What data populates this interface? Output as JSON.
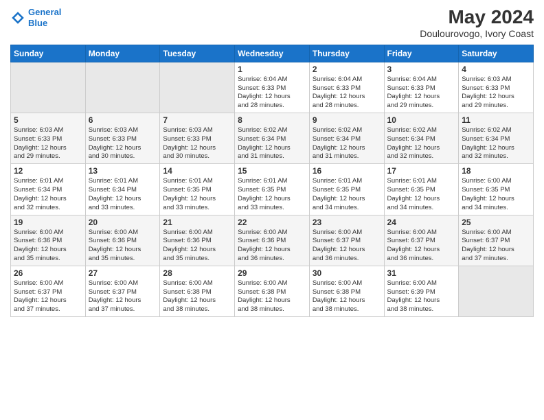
{
  "logo": {
    "line1": "General",
    "line2": "Blue"
  },
  "title": "May 2024",
  "subtitle": "Doulourovogo, Ivory Coast",
  "weekdays": [
    "Sunday",
    "Monday",
    "Tuesday",
    "Wednesday",
    "Thursday",
    "Friday",
    "Saturday"
  ],
  "weeks": [
    [
      {
        "day": "",
        "info": ""
      },
      {
        "day": "",
        "info": ""
      },
      {
        "day": "",
        "info": ""
      },
      {
        "day": "1",
        "info": "Sunrise: 6:04 AM\nSunset: 6:33 PM\nDaylight: 12 hours\nand 28 minutes."
      },
      {
        "day": "2",
        "info": "Sunrise: 6:04 AM\nSunset: 6:33 PM\nDaylight: 12 hours\nand 28 minutes."
      },
      {
        "day": "3",
        "info": "Sunrise: 6:04 AM\nSunset: 6:33 PM\nDaylight: 12 hours\nand 29 minutes."
      },
      {
        "day": "4",
        "info": "Sunrise: 6:03 AM\nSunset: 6:33 PM\nDaylight: 12 hours\nand 29 minutes."
      }
    ],
    [
      {
        "day": "5",
        "info": "Sunrise: 6:03 AM\nSunset: 6:33 PM\nDaylight: 12 hours\nand 29 minutes."
      },
      {
        "day": "6",
        "info": "Sunrise: 6:03 AM\nSunset: 6:33 PM\nDaylight: 12 hours\nand 30 minutes."
      },
      {
        "day": "7",
        "info": "Sunrise: 6:03 AM\nSunset: 6:33 PM\nDaylight: 12 hours\nand 30 minutes."
      },
      {
        "day": "8",
        "info": "Sunrise: 6:02 AM\nSunset: 6:34 PM\nDaylight: 12 hours\nand 31 minutes."
      },
      {
        "day": "9",
        "info": "Sunrise: 6:02 AM\nSunset: 6:34 PM\nDaylight: 12 hours\nand 31 minutes."
      },
      {
        "day": "10",
        "info": "Sunrise: 6:02 AM\nSunset: 6:34 PM\nDaylight: 12 hours\nand 32 minutes."
      },
      {
        "day": "11",
        "info": "Sunrise: 6:02 AM\nSunset: 6:34 PM\nDaylight: 12 hours\nand 32 minutes."
      }
    ],
    [
      {
        "day": "12",
        "info": "Sunrise: 6:01 AM\nSunset: 6:34 PM\nDaylight: 12 hours\nand 32 minutes."
      },
      {
        "day": "13",
        "info": "Sunrise: 6:01 AM\nSunset: 6:34 PM\nDaylight: 12 hours\nand 33 minutes."
      },
      {
        "day": "14",
        "info": "Sunrise: 6:01 AM\nSunset: 6:35 PM\nDaylight: 12 hours\nand 33 minutes."
      },
      {
        "day": "15",
        "info": "Sunrise: 6:01 AM\nSunset: 6:35 PM\nDaylight: 12 hours\nand 33 minutes."
      },
      {
        "day": "16",
        "info": "Sunrise: 6:01 AM\nSunset: 6:35 PM\nDaylight: 12 hours\nand 34 minutes."
      },
      {
        "day": "17",
        "info": "Sunrise: 6:01 AM\nSunset: 6:35 PM\nDaylight: 12 hours\nand 34 minutes."
      },
      {
        "day": "18",
        "info": "Sunrise: 6:00 AM\nSunset: 6:35 PM\nDaylight: 12 hours\nand 34 minutes."
      }
    ],
    [
      {
        "day": "19",
        "info": "Sunrise: 6:00 AM\nSunset: 6:36 PM\nDaylight: 12 hours\nand 35 minutes."
      },
      {
        "day": "20",
        "info": "Sunrise: 6:00 AM\nSunset: 6:36 PM\nDaylight: 12 hours\nand 35 minutes."
      },
      {
        "day": "21",
        "info": "Sunrise: 6:00 AM\nSunset: 6:36 PM\nDaylight: 12 hours\nand 35 minutes."
      },
      {
        "day": "22",
        "info": "Sunrise: 6:00 AM\nSunset: 6:36 PM\nDaylight: 12 hours\nand 36 minutes."
      },
      {
        "day": "23",
        "info": "Sunrise: 6:00 AM\nSunset: 6:37 PM\nDaylight: 12 hours\nand 36 minutes."
      },
      {
        "day": "24",
        "info": "Sunrise: 6:00 AM\nSunset: 6:37 PM\nDaylight: 12 hours\nand 36 minutes."
      },
      {
        "day": "25",
        "info": "Sunrise: 6:00 AM\nSunset: 6:37 PM\nDaylight: 12 hours\nand 37 minutes."
      }
    ],
    [
      {
        "day": "26",
        "info": "Sunrise: 6:00 AM\nSunset: 6:37 PM\nDaylight: 12 hours\nand 37 minutes."
      },
      {
        "day": "27",
        "info": "Sunrise: 6:00 AM\nSunset: 6:37 PM\nDaylight: 12 hours\nand 37 minutes."
      },
      {
        "day": "28",
        "info": "Sunrise: 6:00 AM\nSunset: 6:38 PM\nDaylight: 12 hours\nand 38 minutes."
      },
      {
        "day": "29",
        "info": "Sunrise: 6:00 AM\nSunset: 6:38 PM\nDaylight: 12 hours\nand 38 minutes."
      },
      {
        "day": "30",
        "info": "Sunrise: 6:00 AM\nSunset: 6:38 PM\nDaylight: 12 hours\nand 38 minutes."
      },
      {
        "day": "31",
        "info": "Sunrise: 6:00 AM\nSunset: 6:39 PM\nDaylight: 12 hours\nand 38 minutes."
      },
      {
        "day": "",
        "info": ""
      }
    ]
  ]
}
